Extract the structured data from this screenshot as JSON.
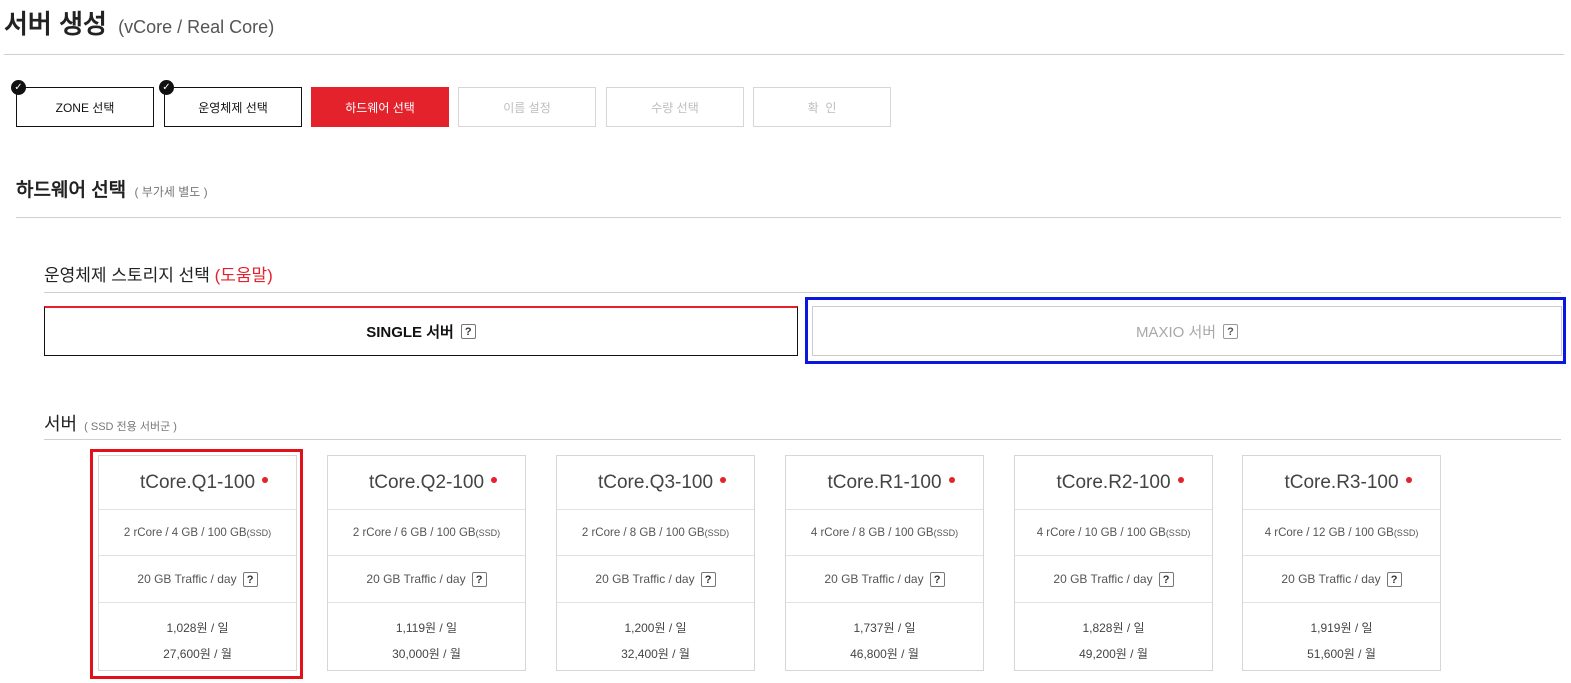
{
  "header": {
    "title": "서버 생성",
    "subtitle": "(vCore / Real Core)"
  },
  "steps": [
    {
      "label": "ZONE 선택",
      "state": "done"
    },
    {
      "label": "운영체제 선택",
      "state": "done"
    },
    {
      "label": "하드웨어 선택",
      "state": "active"
    },
    {
      "label": "이름 설정",
      "state": "todo"
    },
    {
      "label": "수량 선택",
      "state": "todo"
    },
    {
      "label": "확  인",
      "state": "todo"
    }
  ],
  "hardware_section": {
    "title": "하드웨어 선택",
    "note": "( 부가세 별도 )"
  },
  "os_storage": {
    "title": "운영체제 스토리지 선택",
    "help_link": "(도움말)",
    "single_label": "SINGLE 서버",
    "maxio_label": "MAXIO 서버",
    "help_glyph": "?"
  },
  "server_section": {
    "title": "서버",
    "note": "( SSD 전용 서버군 )"
  },
  "cards": [
    {
      "name": "tCore.Q1-100",
      "spec": "2 rCore / 4 GB / 100 GB",
      "ssd": "(SSD)",
      "traffic": "20 GB Traffic / day",
      "daily": "1,028원 / 일",
      "monthly": "27,600원 / 월"
    },
    {
      "name": "tCore.Q2-100",
      "spec": "2 rCore / 6 GB / 100 GB",
      "ssd": "(SSD)",
      "traffic": "20 GB Traffic / day",
      "daily": "1,119원 / 일",
      "monthly": "30,000원 / 월"
    },
    {
      "name": "tCore.Q3-100",
      "spec": "2 rCore / 8 GB / 100 GB",
      "ssd": "(SSD)",
      "traffic": "20 GB Traffic / day",
      "daily": "1,200원 / 일",
      "monthly": "32,400원 / 월"
    },
    {
      "name": "tCore.R1-100",
      "spec": "4 rCore / 8 GB / 100 GB",
      "ssd": "(SSD)",
      "traffic": "20 GB Traffic / day",
      "daily": "1,737원 / 일",
      "monthly": "46,800원 / 월"
    },
    {
      "name": "tCore.R2-100",
      "spec": "4 rCore / 10 GB / 100 GB",
      "ssd": "(SSD)",
      "traffic": "20 GB Traffic / day",
      "daily": "1,828원 / 일",
      "monthly": "49,200원 / 월"
    },
    {
      "name": "tCore.R3-100",
      "spec": "4 rCore / 12 GB / 100 GB",
      "ssd": "(SSD)",
      "traffic": "20 GB Traffic / day",
      "daily": "1,919원 / 일",
      "monthly": "51,600원 / 월"
    }
  ],
  "colors": {
    "accent_red": "#e3222c",
    "highlight_blue": "#0a17e0",
    "highlight_red": "#e3101a"
  }
}
